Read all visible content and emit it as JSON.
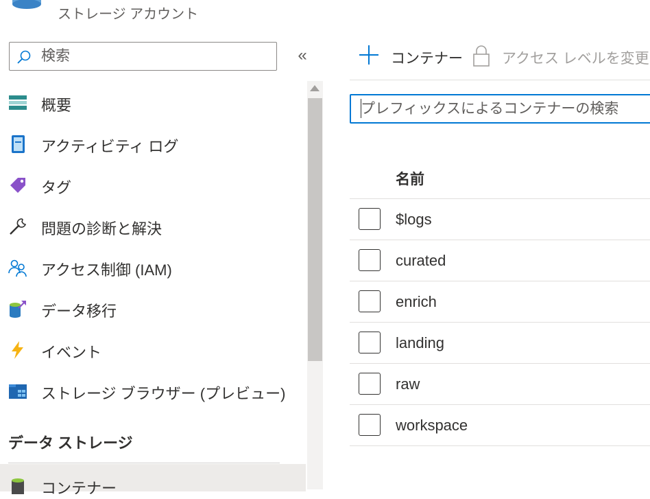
{
  "header": {
    "resource_type": "ストレージ アカウント"
  },
  "sidebar": {
    "search_placeholder": "検索",
    "collapse_glyph": "«",
    "items": [
      {
        "label": "概要",
        "icon": "overview-icon"
      },
      {
        "label": "アクティビティ ログ",
        "icon": "activity-log-icon"
      },
      {
        "label": "タグ",
        "icon": "tag-icon"
      },
      {
        "label": "問題の診断と解決",
        "icon": "wrench-icon"
      },
      {
        "label": "アクセス制御 (IAM)",
        "icon": "people-icon"
      },
      {
        "label": "データ移行",
        "icon": "data-migration-icon"
      },
      {
        "label": "イベント",
        "icon": "lightning-icon"
      },
      {
        "label": "ストレージ ブラウザー (プレビュー)",
        "icon": "storage-browser-icon"
      }
    ],
    "section_title": "データ ストレージ",
    "section_items": [
      {
        "label": "コンテナー",
        "icon": "container-icon",
        "selected": true
      }
    ]
  },
  "toolbar": {
    "add_container_label": "コンテナー",
    "change_access_level_label": "アクセス レベルを変更します"
  },
  "main": {
    "search_placeholder": "プレフィックスによるコンテナーの検索",
    "table": {
      "columns": [
        "名前"
      ],
      "rows": [
        {
          "name": "$logs"
        },
        {
          "name": "curated"
        },
        {
          "name": "enrich"
        },
        {
          "name": "landing"
        },
        {
          "name": "raw"
        },
        {
          "name": "workspace"
        }
      ]
    }
  },
  "colors": {
    "accent": "#0078d4",
    "selected_bg": "#edebe9",
    "text": "#323130",
    "disabled_text": "#a19f9d"
  }
}
